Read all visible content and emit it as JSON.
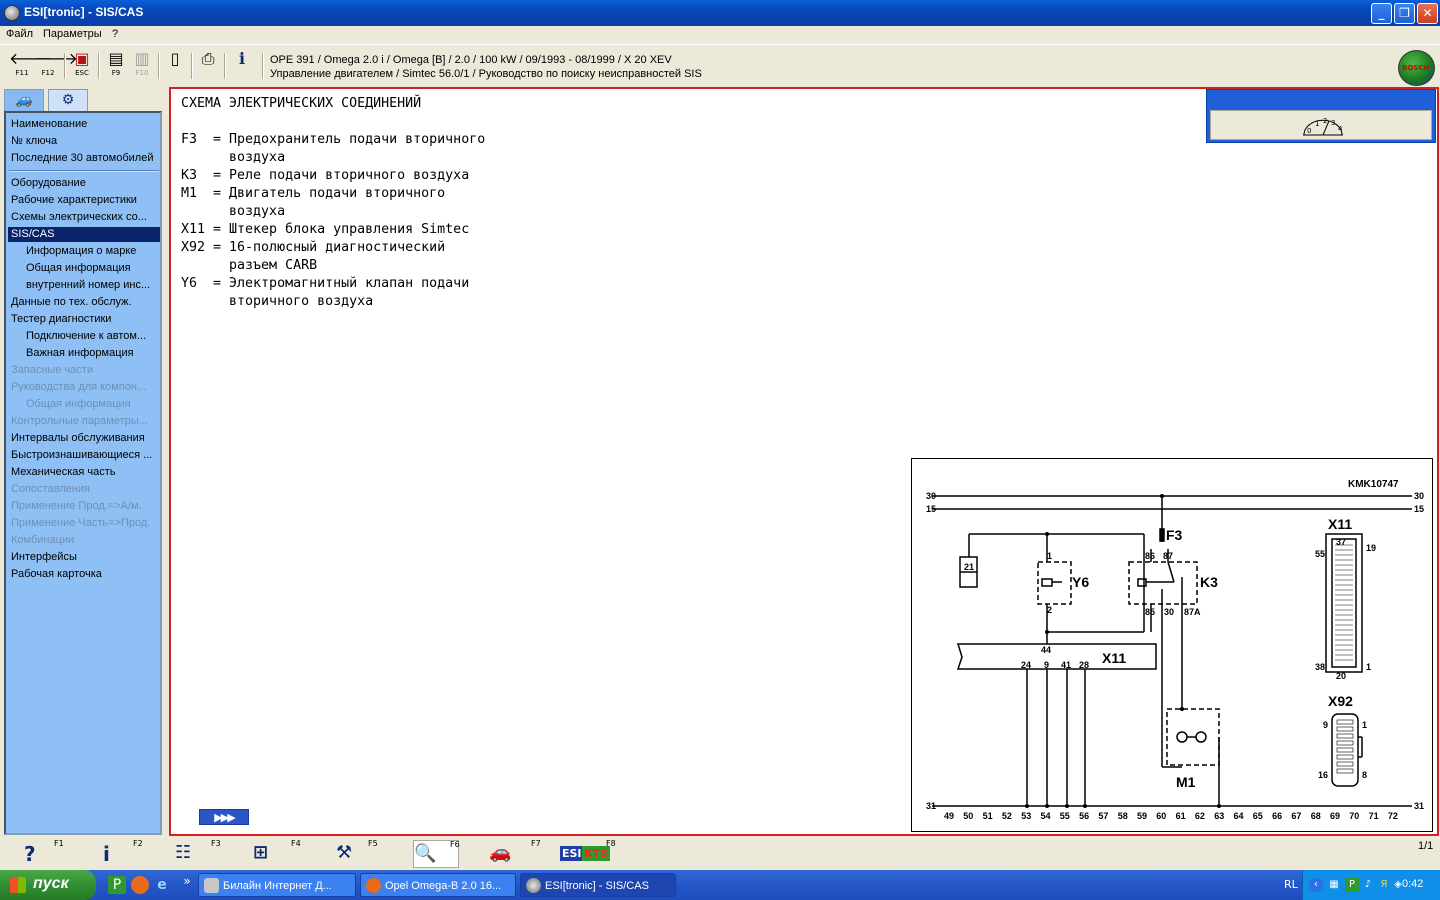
{
  "window": {
    "title": "ESI[tronic] - SIS/CAS",
    "min": "_",
    "max": "❐",
    "close": "✕"
  },
  "menu": [
    "Файл",
    "Параметры",
    "?"
  ],
  "toolbar": {
    "buttons": [
      {
        "glyph": "🡐",
        "key": "F11"
      },
      {
        "glyph": "🡒",
        "key": "F12"
      },
      {
        "glyph": "▣",
        "key": "ESC"
      },
      {
        "glyph": "▤",
        "key": "F9"
      },
      {
        "glyph": "▥",
        "key": "F10"
      },
      {
        "glyph": "▯",
        "key": ""
      },
      {
        "glyph": "⎙",
        "key": ""
      },
      {
        "glyph": "i",
        "key": ""
      }
    ],
    "vehicle_line1": "OPE 391 / Omega 2.0 i / Omega [B] / 2.0 / 100 kW / 09/1993 - 08/1999 / X 20 XEV",
    "vehicle_line2": "Управление двигателем / Simtec 56.0/1 / Руководство по поиску неисправностей SIS",
    "logo_text": "BOSCH"
  },
  "sidebar": {
    "tabs": [
      "🚙",
      "⚙"
    ],
    "group1": [
      "Наименование",
      "№ ключа",
      "Последние 30 автомобилей"
    ],
    "group2": [
      {
        "label": "Оборудование",
        "level": 0,
        "state": "normal"
      },
      {
        "label": "Рабочие характеристики",
        "level": 0,
        "state": "normal"
      },
      {
        "label": "Схемы электрических со...",
        "level": 0,
        "state": "normal"
      },
      {
        "label": "SIS/CAS",
        "level": 0,
        "state": "selected"
      },
      {
        "label": "Информация о марке",
        "level": 1,
        "state": "normal"
      },
      {
        "label": "Общая информация",
        "level": 1,
        "state": "normal"
      },
      {
        "label": "внутренний номер инс...",
        "level": 1,
        "state": "normal"
      },
      {
        "label": "Данные по тех. обслуж.",
        "level": 0,
        "state": "normal"
      },
      {
        "label": "Тестер диагностики",
        "level": 0,
        "state": "normal"
      },
      {
        "label": "Подключение к автом...",
        "level": 1,
        "state": "normal"
      },
      {
        "label": "Важная информация",
        "level": 1,
        "state": "normal"
      },
      {
        "label": "Запасные части",
        "level": 0,
        "state": "disabled"
      },
      {
        "label": "Руководства для компон...",
        "level": 0,
        "state": "disabled"
      },
      {
        "label": "Общая информация",
        "level": 1,
        "state": "disabled"
      },
      {
        "label": "Контрольные параметры...",
        "level": 0,
        "state": "disabled"
      },
      {
        "label": "Интервалы обслуживания",
        "level": 0,
        "state": "normal"
      },
      {
        "label": "Быстроизнашивающиеся ...",
        "level": 0,
        "state": "normal"
      },
      {
        "label": "Механическая часть",
        "level": 0,
        "state": "normal"
      },
      {
        "label": "Сопоставления",
        "level": 0,
        "state": "disabled"
      },
      {
        "label": "Применение Прод.=>А/м.",
        "level": 0,
        "state": "disabled"
      },
      {
        "label": "Применение Часть=>Прод.",
        "level": 0,
        "state": "disabled"
      },
      {
        "label": "Комбинации",
        "level": 0,
        "state": "disabled"
      },
      {
        "label": "Интерфейсы",
        "level": 0,
        "state": "normal"
      },
      {
        "label": "Рабочая карточка",
        "level": 0,
        "state": "normal"
      }
    ]
  },
  "document": {
    "lines": [
      "СХЕМА ЭЛЕКТРИЧЕСКИХ СОЕДИНЕНИЙ",
      "",
      "F3  = Предохранитель подачи вторичного",
      "      воздуха",
      "K3  = Реле подачи вторичного воздуха",
      "M1  = Двигатель подачи вторичного",
      "      воздуха",
      "X11 = Штекер блока управления Simtec",
      "X92 = 16-полюсный диагностический",
      "      разъем CARB",
      "Y6  = Электромагнитный клапан подачи",
      "      вторичного воздуха"
    ],
    "next_button": "▶▶▶"
  },
  "meter": {
    "scale": [
      "0",
      "1",
      "2",
      "3",
      "4"
    ]
  },
  "schematic": {
    "code": "KMK10747",
    "rail_top": "30",
    "rail_15": "15",
    "rail_bottom": "31",
    "labels": {
      "F3": "F3",
      "Y6": "Y6",
      "K3": "K3",
      "X11": "X11",
      "X92": "X92",
      "M1": "M1",
      "box21": "21",
      "y6_pin1": "1",
      "y6_pin2": "2",
      "k3_86": "86",
      "k3_87": "87",
      "k3_85": "85",
      "k3_30": "30",
      "k3_87A": "87A",
      "x11_44": "44",
      "x11_24": "24",
      "x11_9": "9",
      "x11_41": "41",
      "x11_28": "28",
      "c_37": "37",
      "c_55": "55",
      "c_19": "19",
      "c_38": "38",
      "c_20": "20",
      "c_1": "1",
      "d_9": "9",
      "d_1": "1",
      "d_16": "16",
      "d_8": "8"
    },
    "bottom_numbers": [
      "49",
      "50",
      "51",
      "52",
      "53",
      "54",
      "55",
      "56",
      "57",
      "58",
      "59",
      "60",
      "61",
      "62",
      "63",
      "64",
      "65",
      "66",
      "67",
      "68",
      "69",
      "70",
      "71",
      "72"
    ]
  },
  "fbar": {
    "buttons": [
      {
        "glyph": "?",
        "key": "F1"
      },
      {
        "glyph": "i",
        "key": "F2"
      },
      {
        "glyph": "☷",
        "key": "F3"
      },
      {
        "glyph": "⊞",
        "key": "F4"
      },
      {
        "glyph": "⚒",
        "key": "F5"
      },
      {
        "glyph": "🔍",
        "key": "F6"
      },
      {
        "glyph": "🚗",
        "key": "F7"
      },
      {
        "glyph": "ESI",
        "key": "F8",
        "extra": "KTS"
      }
    ],
    "page": "1/1"
  },
  "taskbar": {
    "start": "пуск",
    "tasks": [
      "Билайн Интернет Д...",
      "Opel Omega-B 2.0 16...",
      "ESI[tronic] - SIS/CAS"
    ],
    "lang": "RL",
    "clock": "0:42",
    "overflow": "»"
  }
}
